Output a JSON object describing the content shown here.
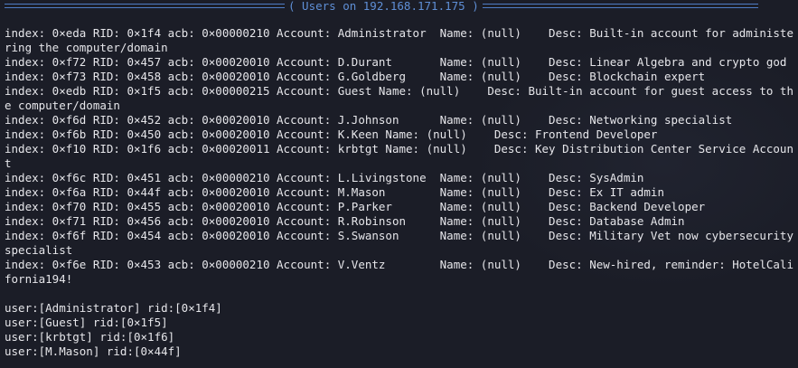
{
  "banner": {
    "title": "( Users on 192.168.171.175 )"
  },
  "accounts": [
    {
      "index": "0xeda",
      "rid": "0x1f4",
      "acb": "0x00000210",
      "account": "Administrator",
      "name": "(null)",
      "desc": "Built-in account for administering the computer/domain"
    },
    {
      "index": "0xf72",
      "rid": "0x457",
      "acb": "0x00020010",
      "account": "D.Durant",
      "name": "(null)",
      "desc": "Linear Algebra and crypto god"
    },
    {
      "index": "0xf73",
      "rid": "0x458",
      "acb": "0x00020010",
      "account": "G.Goldberg",
      "name": "(null)",
      "desc": "Blockchain expert"
    },
    {
      "index": "0xedb",
      "rid": "0x1f5",
      "acb": "0x00000215",
      "account": "Guest",
      "name": "(null)",
      "desc": "Built-in account for guest access to the computer/domain"
    },
    {
      "index": "0xf6d",
      "rid": "0x452",
      "acb": "0x00020010",
      "account": "J.Johnson",
      "name": "(null)",
      "desc": "Networking specialist"
    },
    {
      "index": "0xf6b",
      "rid": "0x450",
      "acb": "0x00020010",
      "account": "K.Keen",
      "name": "(null)",
      "desc": "Frontend Developer"
    },
    {
      "index": "0xf10",
      "rid": "0x1f6",
      "acb": "0x00020011",
      "account": "krbtgt",
      "name": "(null)",
      "desc": "Key Distribution Center Service Account"
    },
    {
      "index": "0xf6c",
      "rid": "0x451",
      "acb": "0x00000210",
      "account": "L.Livingstone",
      "name": "(null)",
      "desc": "SysAdmin"
    },
    {
      "index": "0xf6a",
      "rid": "0x44f",
      "acb": "0x00020010",
      "account": "M.Mason",
      "name": "(null)",
      "desc": "Ex IT admin"
    },
    {
      "index": "0xf70",
      "rid": "0x455",
      "acb": "0x00020010",
      "account": "P.Parker",
      "name": "(null)",
      "desc": "Backend Developer"
    },
    {
      "index": "0xf71",
      "rid": "0x456",
      "acb": "0x00020010",
      "account": "R.Robinson",
      "name": "(null)",
      "desc": "Database Admin"
    },
    {
      "index": "0xf6f",
      "rid": "0x454",
      "acb": "0x00020010",
      "account": "S.Swanson",
      "name": "(null)",
      "desc": "Military Vet now cybersecurity specialist"
    },
    {
      "index": "0xf6e",
      "rid": "0x453",
      "acb": "0x00000210",
      "account": "V.Ventz",
      "name": "(null)",
      "desc": "New-hired, reminder: HotelCalifornia194!"
    }
  ],
  "users": [
    {
      "user": "Administrator",
      "rid": "0x1f4"
    },
    {
      "user": "Guest",
      "rid": "0x1f5"
    },
    {
      "user": "krbtgt",
      "rid": "0x1f6"
    },
    {
      "user": "M.Mason",
      "rid": "0x44f"
    }
  ],
  "colors": {
    "background": "#1b1d27",
    "text": "#e6e6ea",
    "banner": "#5f8fd6"
  }
}
